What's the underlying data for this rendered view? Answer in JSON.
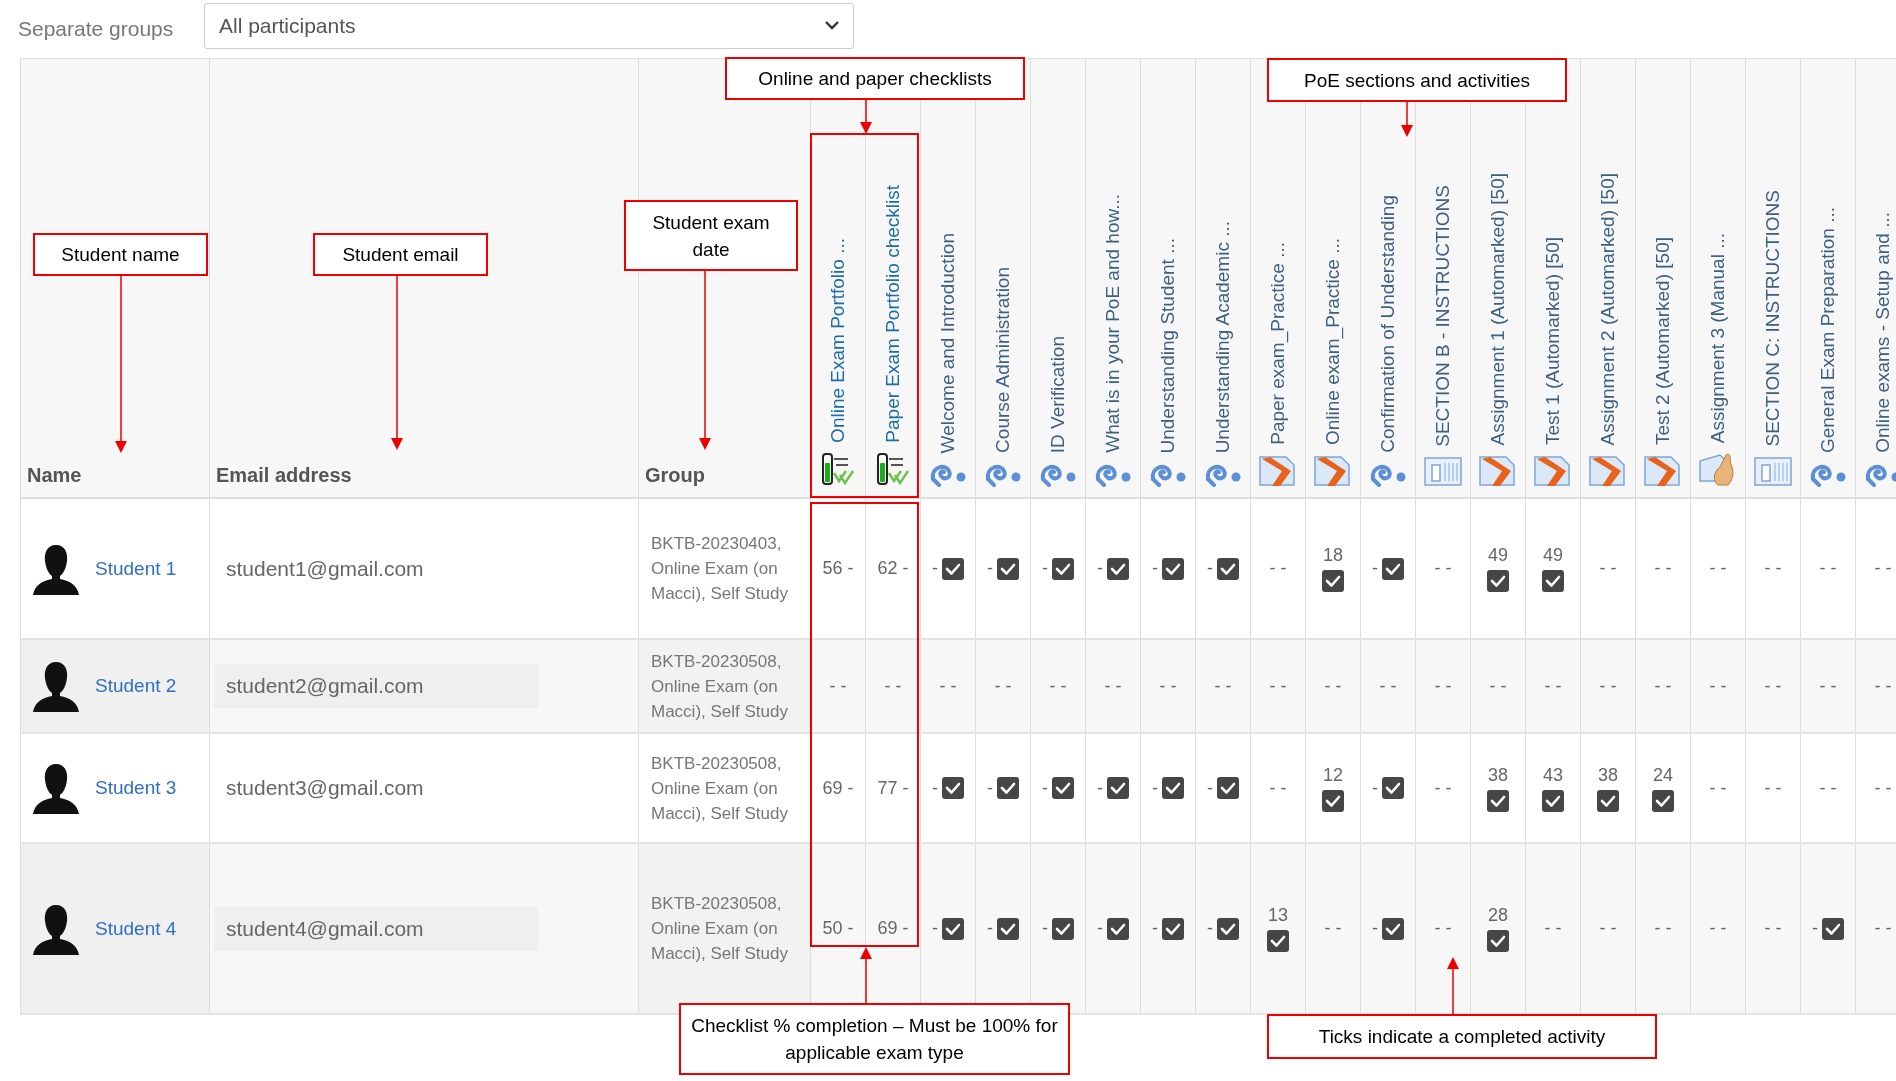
{
  "filter": {
    "label": "Separate groups",
    "value": "All participants"
  },
  "table": {
    "columns": [
      "Name",
      "Email address",
      "Group"
    ],
    "activities": [
      {
        "title": "Online Exam Portfolio ...",
        "kind": "checklist"
      },
      {
        "title": "Paper Exam Portfolio checklist",
        "kind": "checklist"
      },
      {
        "title": "Welcome and Introduction",
        "kind": "swirl"
      },
      {
        "title": "Course Administration",
        "kind": "swirl"
      },
      {
        "title": "ID Verification",
        "kind": "swirl"
      },
      {
        "title": "What is in your PoE and how...",
        "kind": "swirl"
      },
      {
        "title": "Understanding Student ...",
        "kind": "swirl"
      },
      {
        "title": "Understanding Academic ...",
        "kind": "swirl"
      },
      {
        "title": "Paper exam_Practice ...",
        "kind": "assign"
      },
      {
        "title": "Online exam_Practice ...",
        "kind": "assign"
      },
      {
        "title": "Confirmation of Understanding",
        "kind": "swirl"
      },
      {
        "title": "SECTION B - INSTRUCTIONS",
        "kind": "book"
      },
      {
        "title": "Assignment 1 (Automarked) [50]",
        "kind": "assign"
      },
      {
        "title": "Test 1 (Automarked) [50]",
        "kind": "assign"
      },
      {
        "title": "Assignment 2 (Automarked) [50]",
        "kind": "assign"
      },
      {
        "title": "Test 2 (Automarked) [50]",
        "kind": "assign"
      },
      {
        "title": "Assignment 3 (Manual ...",
        "kind": "hand"
      },
      {
        "title": "SECTION C: INSTRUCTIONS",
        "kind": "book"
      },
      {
        "title": "General Exam Preparation ...",
        "kind": "swirl"
      },
      {
        "title": "Online exams - Setup and ...",
        "kind": "swirl"
      }
    ],
    "rows": [
      {
        "name": "Student 1",
        "email": "student1@gmail.com",
        "group": "BKTB-20230403, Online Exam (on Macci), Self Study",
        "cells": [
          {
            "text": "56 -",
            "checked": false
          },
          {
            "text": "62 -",
            "checked": false
          },
          {
            "text": "-",
            "checked": true
          },
          {
            "text": "-",
            "checked": true
          },
          {
            "text": "-",
            "checked": true
          },
          {
            "text": "-",
            "checked": true
          },
          {
            "text": "-",
            "checked": true
          },
          {
            "text": "-",
            "checked": true
          },
          {
            "text": "- -",
            "checked": false
          },
          {
            "text": "18",
            "checked": true,
            "kind": "grade"
          },
          {
            "text": "-",
            "checked": true
          },
          {
            "text": "- -",
            "checked": false
          },
          {
            "text": "49",
            "checked": true,
            "kind": "grade"
          },
          {
            "text": "49",
            "checked": true,
            "kind": "grade"
          },
          {
            "text": "- -",
            "checked": false
          },
          {
            "text": "- -",
            "checked": false
          },
          {
            "text": "- -",
            "checked": false
          },
          {
            "text": "- -",
            "checked": false
          },
          {
            "text": "- -",
            "checked": false
          },
          {
            "text": "- -",
            "checked": false
          }
        ]
      },
      {
        "name": "Student 2",
        "email": "student2@gmail.com",
        "group": "BKTB-20230508, Online Exam (on Macci), Self Study",
        "cells": [
          {
            "text": "- -",
            "checked": false
          },
          {
            "text": "- -",
            "checked": false
          },
          {
            "text": "- -",
            "checked": false
          },
          {
            "text": "- -",
            "checked": false
          },
          {
            "text": "- -",
            "checked": false
          },
          {
            "text": "- -",
            "checked": false
          },
          {
            "text": "- -",
            "checked": false
          },
          {
            "text": "- -",
            "checked": false
          },
          {
            "text": "- -",
            "checked": false
          },
          {
            "text": "- -",
            "checked": false
          },
          {
            "text": "- -",
            "checked": false
          },
          {
            "text": "- -",
            "checked": false
          },
          {
            "text": "- -",
            "checked": false
          },
          {
            "text": "- -",
            "checked": false
          },
          {
            "text": "- -",
            "checked": false
          },
          {
            "text": "- -",
            "checked": false
          },
          {
            "text": "- -",
            "checked": false
          },
          {
            "text": "- -",
            "checked": false
          },
          {
            "text": "- -",
            "checked": false
          },
          {
            "text": "- -",
            "checked": false
          }
        ]
      },
      {
        "name": "Student 3",
        "email": "student3@gmail.com",
        "group": "BKTB-20230508, Online Exam (on Macci), Self Study",
        "cells": [
          {
            "text": "69 -",
            "checked": false
          },
          {
            "text": "77 -",
            "checked": false
          },
          {
            "text": "-",
            "checked": true
          },
          {
            "text": "-",
            "checked": true
          },
          {
            "text": "-",
            "checked": true
          },
          {
            "text": "-",
            "checked": true
          },
          {
            "text": "-",
            "checked": true
          },
          {
            "text": "-",
            "checked": true
          },
          {
            "text": "- -",
            "checked": false
          },
          {
            "text": "12",
            "checked": true,
            "kind": "grade"
          },
          {
            "text": "-",
            "checked": true
          },
          {
            "text": "- -",
            "checked": false
          },
          {
            "text": "38",
            "checked": true,
            "kind": "grade"
          },
          {
            "text": "43",
            "checked": true,
            "kind": "grade"
          },
          {
            "text": "38",
            "checked": true,
            "kind": "grade"
          },
          {
            "text": "24",
            "checked": true,
            "kind": "grade"
          },
          {
            "text": "- -",
            "checked": false
          },
          {
            "text": "- -",
            "checked": false
          },
          {
            "text": "- -",
            "checked": false
          },
          {
            "text": "- -",
            "checked": false
          }
        ]
      },
      {
        "name": "Student 4",
        "email": "student4@gmail.com",
        "group": "BKTB-20230508, Online Exam (on Macci), Self Study",
        "cells": [
          {
            "text": "50 -",
            "checked": false
          },
          {
            "text": "69 -",
            "checked": false
          },
          {
            "text": "-",
            "checked": true
          },
          {
            "text": "-",
            "checked": true
          },
          {
            "text": "-",
            "checked": true
          },
          {
            "text": "-",
            "checked": true
          },
          {
            "text": "-",
            "checked": true
          },
          {
            "text": "-",
            "checked": true
          },
          {
            "text": "13",
            "checked": true,
            "kind": "grade"
          },
          {
            "text": "- -",
            "checked": false
          },
          {
            "text": "-",
            "checked": true
          },
          {
            "text": "- -",
            "checked": false
          },
          {
            "text": "28",
            "checked": true,
            "kind": "grade"
          },
          {
            "text": "- -",
            "checked": false
          },
          {
            "text": "- -",
            "checked": false
          },
          {
            "text": "- -",
            "checked": false
          },
          {
            "text": "- -",
            "checked": false
          },
          {
            "text": "- -",
            "checked": false
          },
          {
            "text": "-",
            "checked": true
          },
          {
            "text": "- -",
            "checked": false
          }
        ]
      }
    ]
  },
  "annotations": [
    {
      "text": "Online and paper checklists"
    },
    {
      "text": "PoE sections and activities"
    },
    {
      "text": "Student name"
    },
    {
      "text": "Student email"
    },
    {
      "text": "Student exam date"
    },
    {
      "text": "Checklist % completion – Must be 100% for applicable exam type"
    },
    {
      "text": "Ticks indicate a completed activity"
    }
  ]
}
